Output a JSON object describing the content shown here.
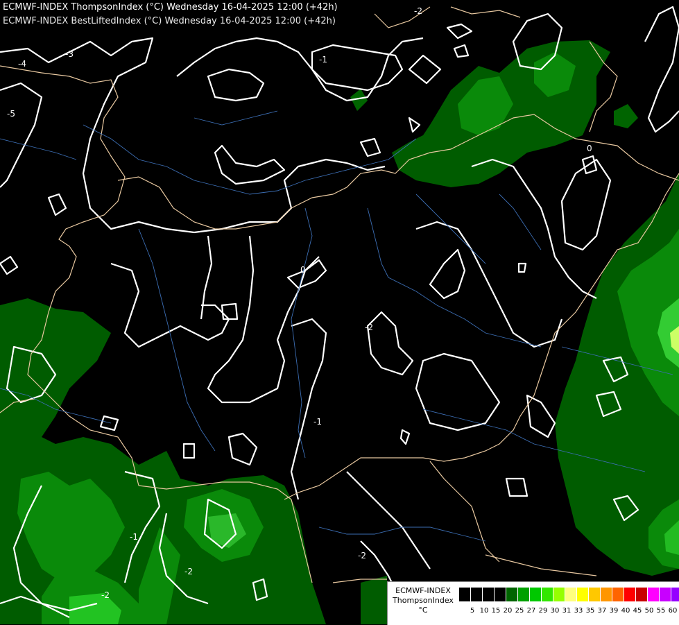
{
  "title": {
    "line1": "ECMWF-INDEX ThompsonIndex (°C) Wednesday 16-04-2025 12:00 (+42h)",
    "line2": "ECMWF-INDEX BestLiftedIndex (°C) Wednesday 16-04-2025 12:00 (+42h)"
  },
  "legend": {
    "line1": "ECMWF-INDEX",
    "line2": "ThompsonIndex",
    "line3": "°C",
    "colors": [
      "#000000",
      "#000000",
      "#000000",
      "#000000",
      "#006400",
      "#00a000",
      "#00c800",
      "#32e600",
      "#96ff00",
      "#ffff7f",
      "#ffff00",
      "#ffc800",
      "#ff9600",
      "#ff6400",
      "#ff0000",
      "#c80000",
      "#ff00ff",
      "#c800ff",
      "#9600ff",
      "#6400ff",
      "#0000ff"
    ],
    "ticks": [
      "5",
      "10",
      "15",
      "20",
      "25",
      "27",
      "29",
      "30",
      "31",
      "33",
      "35",
      "37",
      "39",
      "40",
      "45",
      "50",
      "55",
      "60"
    ]
  },
  "contour_labels": [
    "-4",
    "-3",
    "-5",
    "-2",
    "-1",
    "0",
    "-2",
    "-2",
    "-2",
    "0",
    "-1",
    "-2",
    "-1"
  ]
}
